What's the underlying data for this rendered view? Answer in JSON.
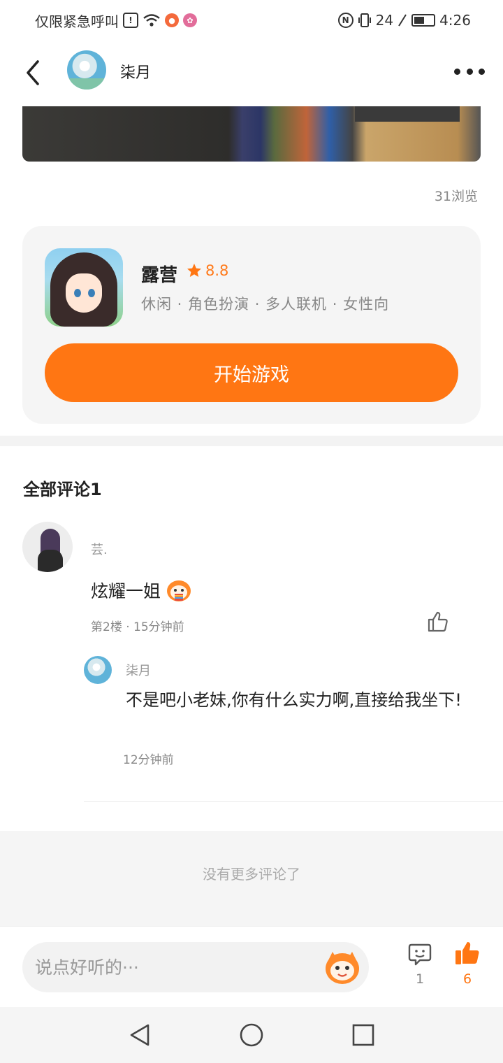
{
  "status_bar": {
    "left_text": "仅限紧急呼叫",
    "network": "24",
    "time": "4:26"
  },
  "header": {
    "username": "柒月"
  },
  "post": {
    "views": "31浏览"
  },
  "game_card": {
    "title": "露营",
    "rating": "8.8",
    "tags": "休闲 · 角色扮演 · 多人联机 · 女性向",
    "start_label": "开始游戏"
  },
  "comments": {
    "section_title": "全部评论1",
    "items": [
      {
        "name": "芸.",
        "text": "炫耀一姐",
        "meta": "第2楼 · 15分钟前",
        "reply": {
          "name": "柒月",
          "text": "不是吧小老妹,你有什么实力啊,直接给我坐下!",
          "meta": "12分钟前"
        }
      }
    ],
    "no_more": "没有更多评论了"
  },
  "bottom_bar": {
    "input_placeholder": "说点好听的···",
    "comment_count": "1",
    "like_count": "6"
  },
  "colors": {
    "accent": "#ff7613",
    "card_bg": "#f5f5f5"
  }
}
